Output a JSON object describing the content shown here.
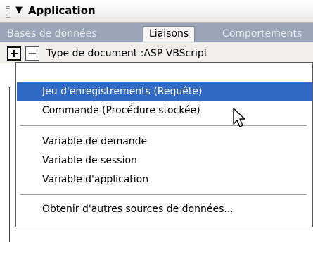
{
  "panel": {
    "title_arrow": "▼",
    "title": "Application"
  },
  "tabs": [
    {
      "label": "Bases de données",
      "active": false
    },
    {
      "label": "Liaisons",
      "active": true
    },
    {
      "label": "Comportements",
      "active": false
    }
  ],
  "toolbar": {
    "add_label": "+",
    "remove_label": "−",
    "doctype_text": "Type de document :ASP VBScript"
  },
  "menu": {
    "items": [
      {
        "label": "Jeu d'enregistrements (Requête)",
        "selected": true
      },
      {
        "label": "Commande (Procédure stockée)",
        "selected": false
      },
      {
        "label": "Variable de demande",
        "selected": false
      },
      {
        "label": "Variable de session",
        "selected": false
      },
      {
        "label": "Variable d'application",
        "selected": false
      },
      {
        "label": "Obtenir d'autres sources de données...",
        "selected": false
      }
    ]
  },
  "colors": {
    "selection": "#3169c6",
    "tab_strip": "#9aa6b8"
  }
}
